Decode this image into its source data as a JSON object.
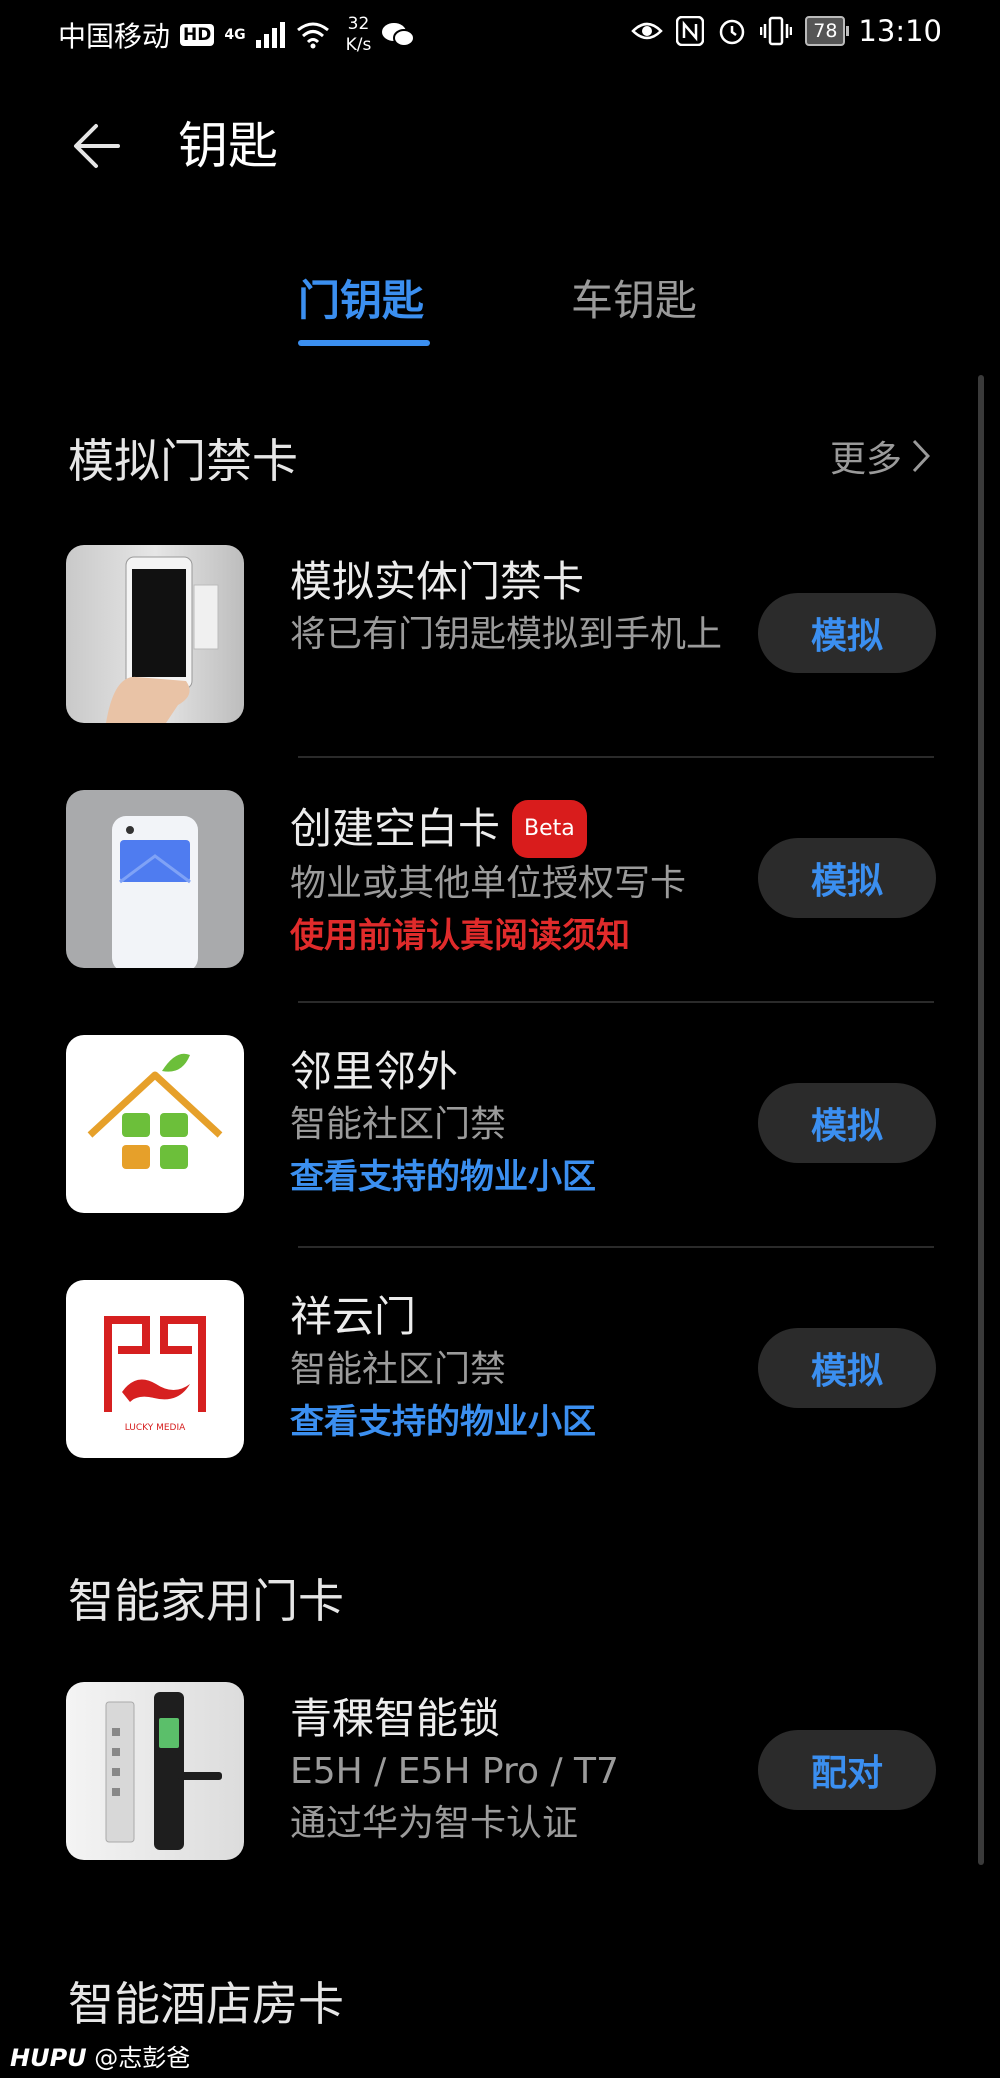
{
  "status_bar": {
    "carrier": "中国移动",
    "hd": "HD",
    "network": "4G",
    "speed_value": "32",
    "speed_unit": "K/s",
    "battery": "78",
    "time": "13:10"
  },
  "header": {
    "title": "钥匙"
  },
  "tabs": [
    {
      "label": "门钥匙",
      "active": true
    },
    {
      "label": "车钥匙",
      "active": false
    }
  ],
  "sections": {
    "access_cards": {
      "title": "模拟门禁卡",
      "more": "更多",
      "items": [
        {
          "title": "模拟实体门禁卡",
          "subtitle": "将已有门钥匙模拟到手机上",
          "action": "模拟"
        },
        {
          "title": "创建空白卡",
          "badge": "Beta",
          "subtitle": "物业或其他单位授权写卡",
          "warning": "使用前请认真阅读须知",
          "action": "模拟"
        },
        {
          "title": "邻里邻外",
          "subtitle": "智能社区门禁",
          "link": "查看支持的物业小区",
          "action": "模拟"
        },
        {
          "title": "祥云门",
          "subtitle": "智能社区门禁",
          "link": "查看支持的物业小区",
          "action": "模拟"
        }
      ]
    },
    "home_cards": {
      "title": "智能家用门卡",
      "items": [
        {
          "title": "青稞智能锁",
          "subtitle": "E5H / E5H Pro / T7",
          "note": "通过华为智卡认证",
          "action": "配对"
        }
      ]
    },
    "hotel_cards": {
      "title": "智能酒店房卡"
    }
  },
  "logo": {
    "text": "LUCKY MEDIA"
  },
  "watermark": {
    "brand": "HUPU",
    "user": "@志彭爸"
  },
  "colors": {
    "accent": "#3b8ff0",
    "warning": "#e02b2b",
    "background": "#000000"
  }
}
